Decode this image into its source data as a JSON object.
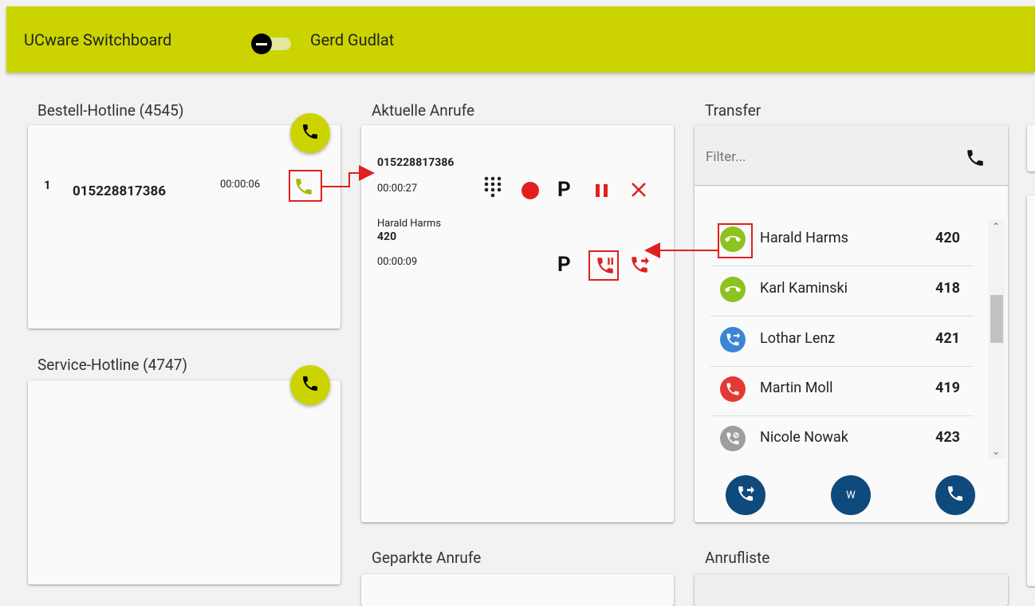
{
  "header": {
    "app_title": "UCware Switchboard",
    "user_name": "Gerd Gudlat"
  },
  "queues": [
    {
      "title": "Bestell-Hotline (4545)",
      "calls": [
        {
          "position": "1",
          "number": "015228817386",
          "duration": "00:00:06"
        }
      ]
    },
    {
      "title": "Service-Hotline (4747)",
      "calls": []
    }
  ],
  "current_calls": {
    "title": "Aktuelle Anrufe",
    "calls": [
      {
        "number": "015228817386",
        "duration": "00:00:27",
        "park_label": "P"
      },
      {
        "name": "Harald Harms",
        "extension": "420",
        "duration": "00:00:09",
        "park_label": "P"
      }
    ]
  },
  "transfer": {
    "title": "Transfer",
    "filter_placeholder": "Filter...",
    "contacts": [
      {
        "name": "Harald Harms",
        "extension": "420",
        "status": "available",
        "color": "#8dc21f"
      },
      {
        "name": "Karl Kaminski",
        "extension": "418",
        "status": "available",
        "color": "#8dc21f"
      },
      {
        "name": "Lothar Lenz",
        "extension": "421",
        "status": "call-forward",
        "color": "#3a86d4"
      },
      {
        "name": "Martin Moll",
        "extension": "419",
        "status": "busy",
        "color": "#e53935"
      },
      {
        "name": "Nicole Nowak",
        "extension": "423",
        "status": "dnd",
        "color": "#9e9e9e"
      }
    ],
    "buttons": {
      "w_label": "W"
    }
  },
  "parked": {
    "title": "Geparkte Anrufe"
  },
  "call_list": {
    "title": "Anrufliste"
  },
  "colors": {
    "accent": "#cbd400",
    "danger": "#e02020",
    "primary": "#0f4a7c"
  }
}
